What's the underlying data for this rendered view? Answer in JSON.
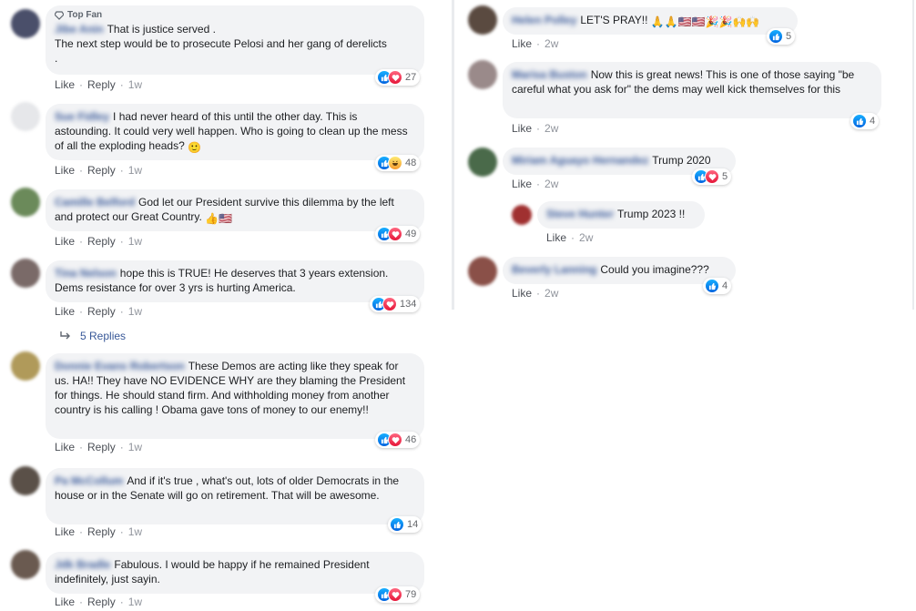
{
  "actions": {
    "like": "Like",
    "reply": "Reply",
    "dot": "·"
  },
  "left": {
    "comments": [
      {
        "badge": "Top Fan",
        "author": "Jibe Anin",
        "text": "That is justice served .\nThe next step would be to prosecute Pelosi and her gang of derelicts\n.",
        "time": "1w",
        "reactions": [
          "like",
          "love"
        ],
        "count": "27",
        "avatar_color": "#4a4f6a"
      },
      {
        "author": "Sue Fidley",
        "text": "I had never heard of this until the other day. This is astounding. It could very well happen. Who is going to clean up the mess of all the exploding heads? ",
        "emoji": "🙂",
        "time": "1w",
        "reactions": [
          "like",
          "haha"
        ],
        "count": "48",
        "avatar_color": "#e6e7ea"
      },
      {
        "author": "Camille Belford",
        "text": "God let our President survive this dilemma by the left and protect our Great Country. ",
        "emoji": "👍🇺🇸",
        "time": "1w",
        "reactions": [
          "like",
          "love"
        ],
        "count": "49",
        "avatar_color": "#6b8a5a"
      },
      {
        "author": "Tina Nelson",
        "text": "hope this is TRUE! He deserves that 3 years extension. Dems resistance for over 3 yrs is hurting America.",
        "time": "1w",
        "reactions": [
          "like",
          "love"
        ],
        "count": "134",
        "avatar_color": "#7a6a68"
      },
      {
        "author": "Donnie Evans Robertson",
        "text": "These Demos are acting like they speak for us. HA!! They have NO EVIDENCE WHY are they blaming the President for things. He should stand firm. And withholding money from another country is his calling ! Obama gave tons of money to our enemy!!",
        "time": "1w",
        "reactions": [
          "like",
          "love"
        ],
        "count": "46",
        "avatar_color": "#b09a5a"
      },
      {
        "author": "Pa McCollum",
        "text": "And if it's true , what's out, lots of older Democrats in the house or in the Senate will go on retirement. That will be awesome.",
        "time": "1w",
        "reactions": [
          "like"
        ],
        "count": "14",
        "avatar_color": "#5a5048"
      },
      {
        "author": "Jdk Bradle",
        "text": "Fabulous. I would be happy if he remained President indefinitely, just sayin.",
        "time": "1w",
        "reactions": [
          "like",
          "love"
        ],
        "count": "79",
        "avatar_color": "#6a5a50"
      }
    ],
    "replies_link": "5 Replies"
  },
  "right": {
    "comments": [
      {
        "author": "Helen Polley",
        "text": "LET'S PRAY!!",
        "emoji": "🙏🙏🇺🇸🇺🇸🎉🎉🙌🙌",
        "time": "2w",
        "reactions": [
          "like"
        ],
        "count": "5",
        "avatar_color": "#5a4a40"
      },
      {
        "author": "Marisa Buston",
        "text": "Now this is great news! This is one of those saying \"be careful what you ask for\" the dems may well kick themselves for this",
        "time": "2w",
        "reactions": [
          "like"
        ],
        "count": "4",
        "avatar_color": "#9a8a8a"
      },
      {
        "author": "Miriam Aguayo Hernandez",
        "text": "Trump 2020",
        "time": "2w",
        "reactions": [
          "like",
          "love"
        ],
        "count": "5",
        "avatar_color": "#4a6a4a"
      },
      {
        "author": "Steve Hunter",
        "text": "Trump 2023 !!",
        "time": "2w",
        "reactions": [],
        "count": "",
        "avatar_color": "#a03030"
      },
      {
        "author": "Beverly Lanning",
        "text": "Could you imagine???",
        "time": "2w",
        "reactions": [
          "like"
        ],
        "count": "4",
        "avatar_color": "#8a5048"
      }
    ]
  },
  "icons": {
    "like": "like-icon",
    "love": "love-icon",
    "haha": "haha-icon",
    "diamond": "diamond-icon",
    "reply_arrow": "reply-arrow-icon"
  },
  "colors": {
    "bubble": "#f2f3f5",
    "link": "#385898",
    "meta": "#606770"
  }
}
